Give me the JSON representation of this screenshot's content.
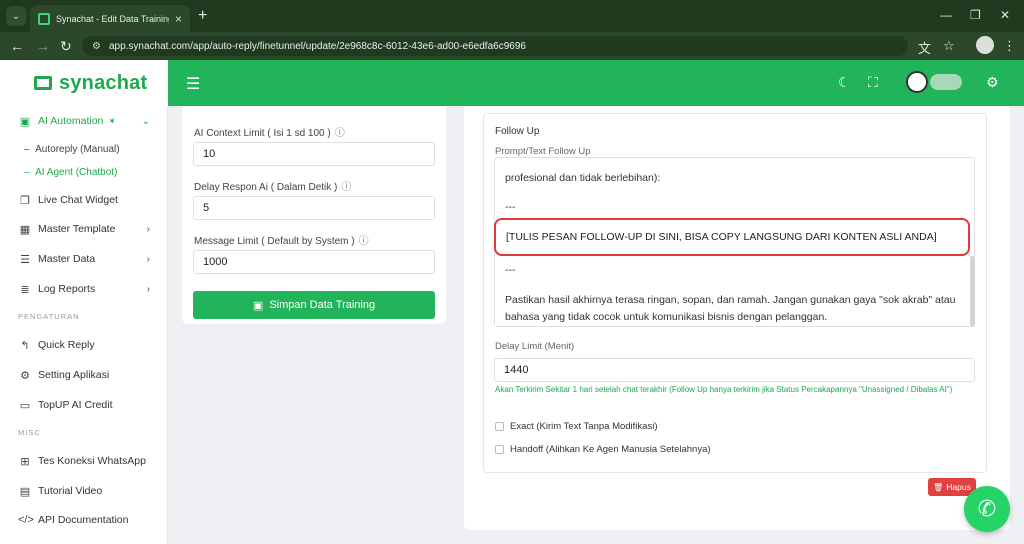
{
  "browser": {
    "tab_title": "Synachat - Edit Data Training AI",
    "url": "app.synachat.com/app/auto-reply/finetunnel/update/2e968c8c-6012-43e6-ad00-e6edfa6c9696"
  },
  "app": {
    "logo": "synachat",
    "accent_color": "#22b45a"
  },
  "sidebar": {
    "ai_automation": "AI Automation",
    "sub_autoreply": "Autoreply (Manual)",
    "sub_ai_agent": "AI Agent (Chatbot)",
    "live_chat": "Live Chat Widget",
    "master_template": "Master Template",
    "master_data": "Master Data",
    "log_reports": "Log Reports",
    "section_pengaturan": "PENGATURAN",
    "quick_reply": "Quick Reply",
    "setting_aplikasi": "Setting Aplikasi",
    "topup": "TopUP AI Credit",
    "section_misc": "MISC",
    "tes_koneksi": "Tes Koneksi WhatsApp",
    "tutorial": "Tutorial Video",
    "api_docs": "API Documentation"
  },
  "left_form": {
    "context_limit_label": "AI Context Limit ( Isi 1 sd 100 )",
    "context_limit_value": "10",
    "delay_label": "Delay Respon Ai ( Dalam Detik )",
    "delay_value": "5",
    "message_limit_label": "Message Limit ( Default by System )",
    "message_limit_value": "1000",
    "save_button": "Simpan Data Training"
  },
  "follow_up": {
    "title": "Follow Up",
    "prompt_label": "Prompt/Text Follow Up",
    "text_line_1": "profesional dan tidak berlebihan):",
    "text_sep_1": "---",
    "highlight": "[TULIS PESAN FOLLOW-UP DI SINI, BISA COPY LANGSUNG DARI KONTEN ASLI ANDA]",
    "text_sep_2": "---",
    "text_line_2": "Pastikan hasil akhirnya terasa ringan, sopan, dan ramah. Jangan gunakan gaya \"sok akrab\" atau",
    "text_line_3": "bahasa yang tidak cocok untuk komunikasi bisnis dengan pelanggan.",
    "delay_label": "Delay Limit (Menit)",
    "delay_value": "1440",
    "help_text": "Akan Terkirim Sekitar 1 hari setelah chat terakhir (Follow Up hanya terkirim jika Status Percakapannya \"Unassigned / Dibalas AI\")",
    "exact_label": "Exact (Kirim Text Tanpa Modifikasi)",
    "handoff_label": "Handoff (Alihkan Ke Agen Manusia Setelahnya)",
    "delete_button": "Hapus"
  }
}
